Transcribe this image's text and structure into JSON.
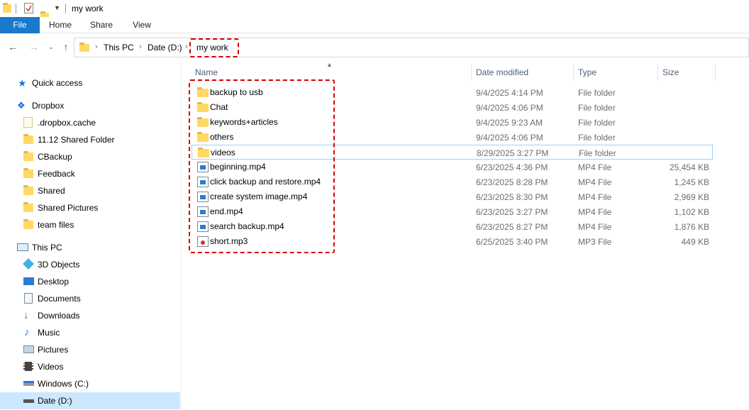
{
  "window": {
    "title": "my work"
  },
  "ribbon": {
    "tabs": [
      "File",
      "Home",
      "Share",
      "View"
    ]
  },
  "address": {
    "crumbs": [
      "This PC",
      "Date (D:)",
      "my work"
    ]
  },
  "sidebar": {
    "quick_access": "Quick access",
    "dropbox": "Dropbox",
    "dropbox_items": [
      ".dropbox.cache",
      "11.12 Shared Folder",
      "CBackup",
      "Feedback",
      "Shared",
      "Shared Pictures",
      "team files"
    ],
    "this_pc": "This PC",
    "pc_items": [
      "3D Objects",
      "Desktop",
      "Documents",
      "Downloads",
      "Music",
      "Pictures",
      "Videos",
      "Windows (C:)",
      "Date (D:)"
    ]
  },
  "columns": {
    "name": "Name",
    "date": "Date modified",
    "type": "Type",
    "size": "Size"
  },
  "files": [
    {
      "name": "backup to usb",
      "date": "9/4/2025 4:14 PM",
      "type": "File folder",
      "size": "",
      "icon": "folder-icon"
    },
    {
      "name": "Chat",
      "date": "9/4/2025 4:06 PM",
      "type": "File folder",
      "size": "",
      "icon": "folder-icon"
    },
    {
      "name": "keywords+articles",
      "date": "9/4/2025 9:23 AM",
      "type": "File folder",
      "size": "",
      "icon": "folder-icon"
    },
    {
      "name": "others",
      "date": "9/4/2025 4:06 PM",
      "type": "File folder",
      "size": "",
      "icon": "folder-icon"
    },
    {
      "name": "videos",
      "date": "8/29/2025 3:27 PM",
      "type": "File folder",
      "size": "",
      "icon": "folder-icon"
    },
    {
      "name": "beginning.mp4",
      "date": "6/23/2025 4:36 PM",
      "type": "MP4 File",
      "size": "25,454 KB",
      "icon": "video-file-icon"
    },
    {
      "name": "click backup and restore.mp4",
      "date": "6/23/2025 8:28 PM",
      "type": "MP4 File",
      "size": "1,245 KB",
      "icon": "video-file-icon"
    },
    {
      "name": "create system image.mp4",
      "date": "6/23/2025 8:30 PM",
      "type": "MP4 File",
      "size": "2,969 KB",
      "icon": "video-file-icon"
    },
    {
      "name": "end.mp4",
      "date": "6/23/2025 3:27 PM",
      "type": "MP4 File",
      "size": "1,102 KB",
      "icon": "video-file-icon"
    },
    {
      "name": "search backup.mp4",
      "date": "6/23/2025 8:27 PM",
      "type": "MP4 File",
      "size": "1,876 KB",
      "icon": "video-file-icon"
    },
    {
      "name": "short.mp3",
      "date": "6/25/2025 3:40 PM",
      "type": "MP3 File",
      "size": "449 KB",
      "icon": "audio-file-icon"
    }
  ],
  "colors": {
    "accent": "#1979ca",
    "highlight": "#d90000",
    "selection": "#cce8ff"
  }
}
